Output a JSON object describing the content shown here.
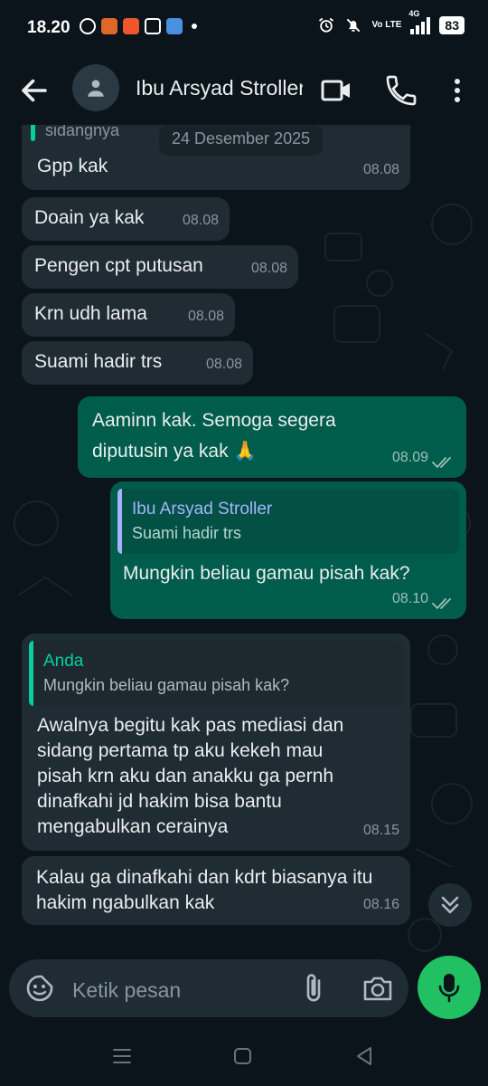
{
  "status_bar": {
    "time": "18.20",
    "battery": "83",
    "network": "4G",
    "volte": "Vo LTE"
  },
  "header": {
    "contact_name": "Ibu Arsyad Stroller"
  },
  "chat": {
    "date_separator": "24 Desember 2025",
    "partial_top_text": "sidangnya",
    "messages": [
      {
        "direction": "incoming",
        "text": "Gpp kak",
        "time": "08.08"
      },
      {
        "direction": "incoming",
        "text": "Doain ya kak",
        "time": "08.08"
      },
      {
        "direction": "incoming",
        "text": "Pengen cpt putusan",
        "time": "08.08"
      },
      {
        "direction": "incoming",
        "text": "Krn udh lama",
        "time": "08.08"
      },
      {
        "direction": "incoming",
        "text": "Suami hadir trs",
        "time": "08.08"
      },
      {
        "direction": "outgoing",
        "text": "Aaminn kak. Semoga segera diputusin ya kak 🙏",
        "time": "08.09",
        "status": "read"
      },
      {
        "direction": "outgoing",
        "reply_to": {
          "author": "Ibu Arsyad Stroller",
          "text": "Suami hadir trs"
        },
        "text": "Mungkin beliau gamau pisah kak?",
        "time": "08.10",
        "status": "read"
      },
      {
        "direction": "incoming",
        "reply_to": {
          "author": "Anda",
          "text": "Mungkin beliau gamau pisah kak?"
        },
        "text": "Awalnya begitu kak pas mediasi dan sidang pertama tp aku kekeh mau pisah krn aku dan anakku ga pernh dinafkahi jd hakim bisa bantu mengabulkan cerainya",
        "time": "08.15"
      },
      {
        "direction": "incoming",
        "text": "Kalau ga dinafkahi dan kdrt biasanya itu hakim ngabulkan kak",
        "time": "08.16"
      }
    ]
  },
  "composer": {
    "placeholder": "Ketik pesan"
  },
  "colors": {
    "background": "#0b141a",
    "incoming_bubble": "#202c33",
    "outgoing_bubble": "#005c4b",
    "accent_green": "#21c063",
    "quote_self": "#06cf9c",
    "quote_contact": "#a5b3ff"
  },
  "icons": [
    "back-arrow-icon",
    "person-icon",
    "video-call-icon",
    "phone-icon",
    "more-vert-icon",
    "double-check-icon",
    "scroll-down-icon",
    "emoji-sticker-icon",
    "paperclip-icon",
    "camera-icon",
    "mic-icon",
    "nav-recents-icon",
    "nav-home-icon",
    "nav-back-icon"
  ]
}
